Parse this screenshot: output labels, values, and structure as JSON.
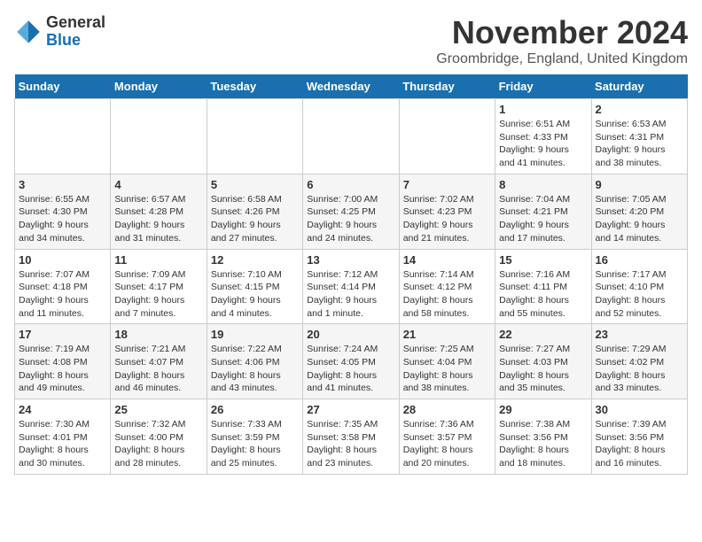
{
  "header": {
    "logo": {
      "general": "General",
      "blue": "Blue"
    },
    "title": "November 2024",
    "location": "Groombridge, England, United Kingdom"
  },
  "weekdays": [
    "Sunday",
    "Monday",
    "Tuesday",
    "Wednesday",
    "Thursday",
    "Friday",
    "Saturday"
  ],
  "weeks": [
    [
      {
        "day": "",
        "info": ""
      },
      {
        "day": "",
        "info": ""
      },
      {
        "day": "",
        "info": ""
      },
      {
        "day": "",
        "info": ""
      },
      {
        "day": "",
        "info": ""
      },
      {
        "day": "1",
        "info": "Sunrise: 6:51 AM\nSunset: 4:33 PM\nDaylight: 9 hours\nand 41 minutes."
      },
      {
        "day": "2",
        "info": "Sunrise: 6:53 AM\nSunset: 4:31 PM\nDaylight: 9 hours\nand 38 minutes."
      }
    ],
    [
      {
        "day": "3",
        "info": "Sunrise: 6:55 AM\nSunset: 4:30 PM\nDaylight: 9 hours\nand 34 minutes."
      },
      {
        "day": "4",
        "info": "Sunrise: 6:57 AM\nSunset: 4:28 PM\nDaylight: 9 hours\nand 31 minutes."
      },
      {
        "day": "5",
        "info": "Sunrise: 6:58 AM\nSunset: 4:26 PM\nDaylight: 9 hours\nand 27 minutes."
      },
      {
        "day": "6",
        "info": "Sunrise: 7:00 AM\nSunset: 4:25 PM\nDaylight: 9 hours\nand 24 minutes."
      },
      {
        "day": "7",
        "info": "Sunrise: 7:02 AM\nSunset: 4:23 PM\nDaylight: 9 hours\nand 21 minutes."
      },
      {
        "day": "8",
        "info": "Sunrise: 7:04 AM\nSunset: 4:21 PM\nDaylight: 9 hours\nand 17 minutes."
      },
      {
        "day": "9",
        "info": "Sunrise: 7:05 AM\nSunset: 4:20 PM\nDaylight: 9 hours\nand 14 minutes."
      }
    ],
    [
      {
        "day": "10",
        "info": "Sunrise: 7:07 AM\nSunset: 4:18 PM\nDaylight: 9 hours\nand 11 minutes."
      },
      {
        "day": "11",
        "info": "Sunrise: 7:09 AM\nSunset: 4:17 PM\nDaylight: 9 hours\nand 7 minutes."
      },
      {
        "day": "12",
        "info": "Sunrise: 7:10 AM\nSunset: 4:15 PM\nDaylight: 9 hours\nand 4 minutes."
      },
      {
        "day": "13",
        "info": "Sunrise: 7:12 AM\nSunset: 4:14 PM\nDaylight: 9 hours\nand 1 minute."
      },
      {
        "day": "14",
        "info": "Sunrise: 7:14 AM\nSunset: 4:12 PM\nDaylight: 8 hours\nand 58 minutes."
      },
      {
        "day": "15",
        "info": "Sunrise: 7:16 AM\nSunset: 4:11 PM\nDaylight: 8 hours\nand 55 minutes."
      },
      {
        "day": "16",
        "info": "Sunrise: 7:17 AM\nSunset: 4:10 PM\nDaylight: 8 hours\nand 52 minutes."
      }
    ],
    [
      {
        "day": "17",
        "info": "Sunrise: 7:19 AM\nSunset: 4:08 PM\nDaylight: 8 hours\nand 49 minutes."
      },
      {
        "day": "18",
        "info": "Sunrise: 7:21 AM\nSunset: 4:07 PM\nDaylight: 8 hours\nand 46 minutes."
      },
      {
        "day": "19",
        "info": "Sunrise: 7:22 AM\nSunset: 4:06 PM\nDaylight: 8 hours\nand 43 minutes."
      },
      {
        "day": "20",
        "info": "Sunrise: 7:24 AM\nSunset: 4:05 PM\nDaylight: 8 hours\nand 41 minutes."
      },
      {
        "day": "21",
        "info": "Sunrise: 7:25 AM\nSunset: 4:04 PM\nDaylight: 8 hours\nand 38 minutes."
      },
      {
        "day": "22",
        "info": "Sunrise: 7:27 AM\nSunset: 4:03 PM\nDaylight: 8 hours\nand 35 minutes."
      },
      {
        "day": "23",
        "info": "Sunrise: 7:29 AM\nSunset: 4:02 PM\nDaylight: 8 hours\nand 33 minutes."
      }
    ],
    [
      {
        "day": "24",
        "info": "Sunrise: 7:30 AM\nSunset: 4:01 PM\nDaylight: 8 hours\nand 30 minutes."
      },
      {
        "day": "25",
        "info": "Sunrise: 7:32 AM\nSunset: 4:00 PM\nDaylight: 8 hours\nand 28 minutes."
      },
      {
        "day": "26",
        "info": "Sunrise: 7:33 AM\nSunset: 3:59 PM\nDaylight: 8 hours\nand 25 minutes."
      },
      {
        "day": "27",
        "info": "Sunrise: 7:35 AM\nSunset: 3:58 PM\nDaylight: 8 hours\nand 23 minutes."
      },
      {
        "day": "28",
        "info": "Sunrise: 7:36 AM\nSunset: 3:57 PM\nDaylight: 8 hours\nand 20 minutes."
      },
      {
        "day": "29",
        "info": "Sunrise: 7:38 AM\nSunset: 3:56 PM\nDaylight: 8 hours\nand 18 minutes."
      },
      {
        "day": "30",
        "info": "Sunrise: 7:39 AM\nSunset: 3:56 PM\nDaylight: 8 hours\nand 16 minutes."
      }
    ]
  ]
}
